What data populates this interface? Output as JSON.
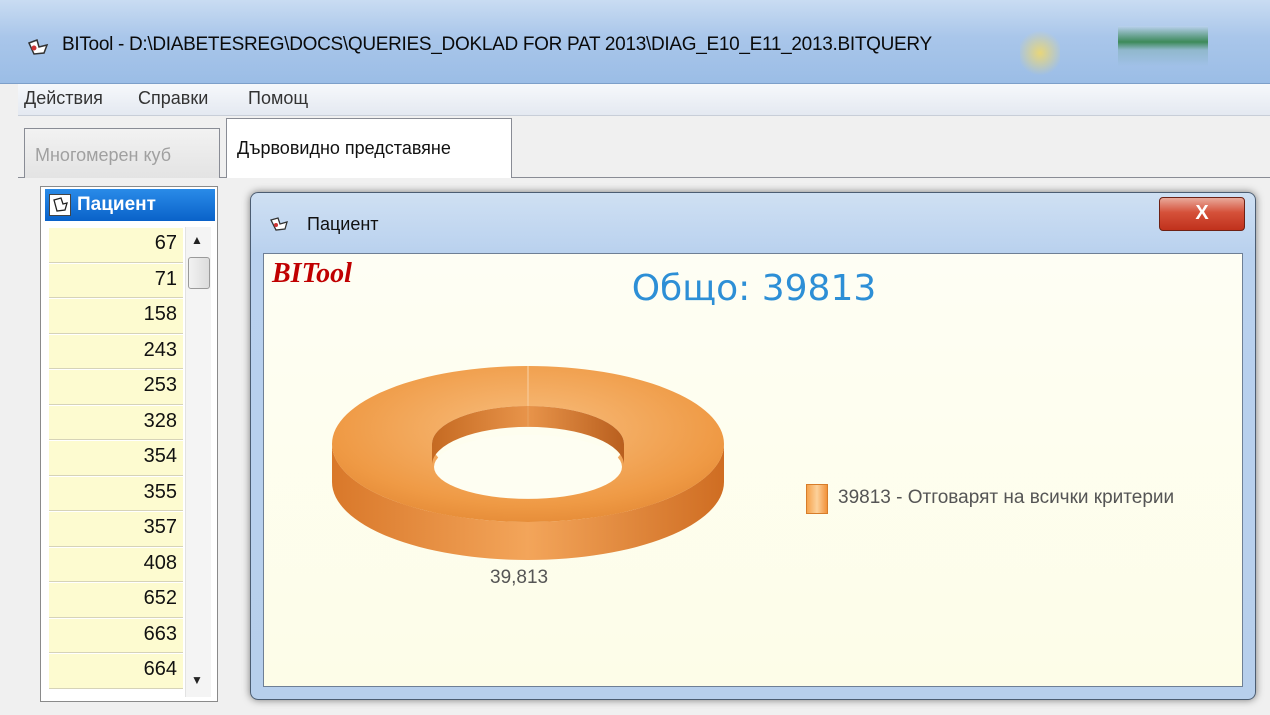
{
  "window": {
    "title": "BITool - D:\\DIABETESREG\\DOCS\\QUERIES_DOKLAD FOR PAT 2013\\DIAG_E10_E11_2013.BITQUERY"
  },
  "menu": {
    "items": [
      "Действия",
      "Справки",
      "Помощ"
    ]
  },
  "tabs": [
    {
      "label": "Многомерен куб",
      "active": false
    },
    {
      "label": "Дървовидно представяне",
      "active": true
    }
  ],
  "patient_list": {
    "header": "Пациент",
    "rows": [
      "67",
      "71",
      "158",
      "243",
      "253",
      "328",
      "354",
      "355",
      "357",
      "408",
      "652",
      "663",
      "664"
    ]
  },
  "child_window": {
    "title": "Пациент",
    "close_label": "X"
  },
  "chart": {
    "logo": "BITool",
    "title": "Общо: 39813",
    "slice_label": "39,813",
    "legend": "39813 - Отговарят на всички критерии",
    "color": "#ef9a45"
  },
  "chart_data": {
    "type": "pie",
    "title": "Общо: 39813",
    "categories": [
      "39813 - Отговарят на всички критерии"
    ],
    "values": [
      39813
    ],
    "data_labels": [
      "39,813"
    ],
    "legend_position": "right"
  }
}
